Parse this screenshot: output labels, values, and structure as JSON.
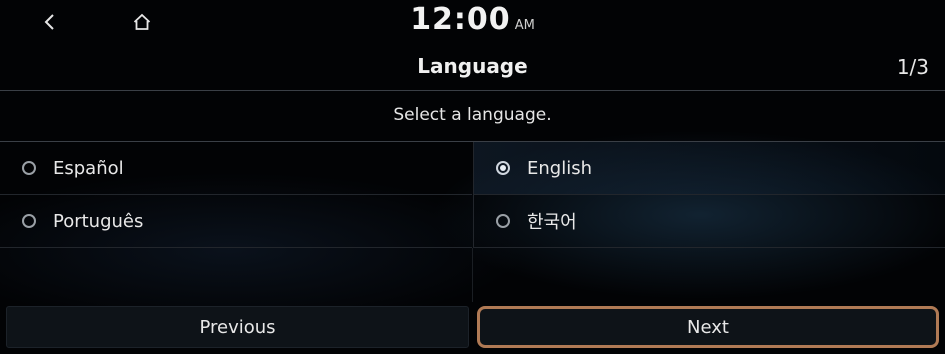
{
  "status_bar": {
    "back_icon": "chevron-left-icon",
    "home_icon": "home-icon",
    "time": "12:00",
    "ampm": "AM"
  },
  "header": {
    "title": "Language",
    "page_indicator": "1/3"
  },
  "instruction": "Select a language.",
  "languages": [
    {
      "label": "Español",
      "selected": false
    },
    {
      "label": "English",
      "selected": true
    },
    {
      "label": "Português",
      "selected": false
    },
    {
      "label": "한국어",
      "selected": false
    }
  ],
  "buttons": {
    "previous": "Previous",
    "next": "Next"
  },
  "colors": {
    "focus_outline": "#b07a55",
    "background": "#020305"
  }
}
